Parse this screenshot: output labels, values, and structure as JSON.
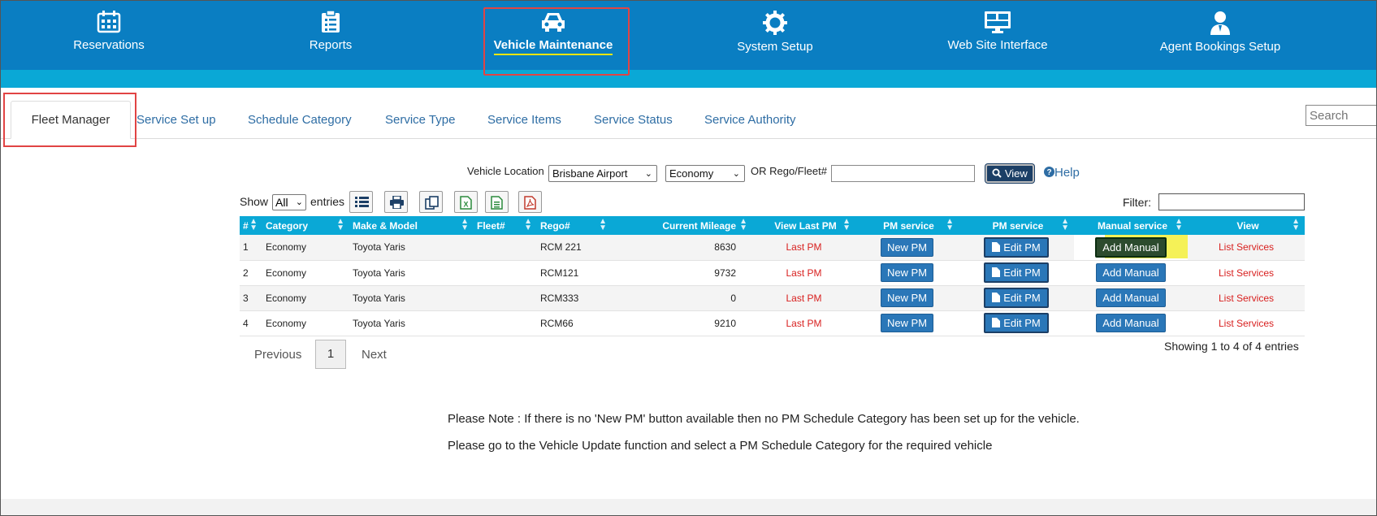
{
  "nav": {
    "items": [
      {
        "label": "Reservations",
        "icon": "calendar-icon"
      },
      {
        "label": "Reports",
        "icon": "checklist-icon"
      },
      {
        "label": "Vehicle Maintenance",
        "icon": "car-icon",
        "active": true
      },
      {
        "label": "System Setup",
        "icon": "gear-icon"
      },
      {
        "label": "Web Site Interface",
        "icon": "monitor-icon"
      },
      {
        "label": "Agent Bookings Setup",
        "icon": "user-icon"
      }
    ],
    "color": "#0a7ec2",
    "strip_color": "#0aa8d6"
  },
  "tabs": [
    {
      "label": "Fleet Manager",
      "active": true
    },
    {
      "label": "Service Set up"
    },
    {
      "label": "Schedule Category"
    },
    {
      "label": "Service Type"
    },
    {
      "label": "Service Items"
    },
    {
      "label": "Service Status"
    },
    {
      "label": "Service Authority"
    }
  ],
  "search": {
    "placeholder": "Search"
  },
  "filters": {
    "location_label": "Vehicle Location",
    "location_value": "Brisbane Airport",
    "category_value": "Economy",
    "rego_label": "OR Rego/Fleet#",
    "view_label": "View",
    "help_label": "Help"
  },
  "toolbar": {
    "show_label": "Show",
    "show_value": "All",
    "entries_label": "entries",
    "filter_label": "Filter:",
    "buttons": [
      "list-icon",
      "print-icon",
      "copy-icon",
      "excel-icon",
      "csv-icon",
      "pdf-icon"
    ]
  },
  "table": {
    "headers": [
      "#",
      "Category",
      "Make & Model",
      "Fleet#",
      "Rego#",
      "Current Mileage",
      "View Last PM",
      "PM service",
      "PM service",
      "Manual service",
      "View"
    ],
    "rows": [
      {
        "n": "1",
        "category": "Economy",
        "make": "Toyota Yaris",
        "fleet": "",
        "rego": "RCM 221",
        "mileage": "8630",
        "last_pm": "Last PM",
        "new_pm": "New PM",
        "edit_pm": "Edit PM",
        "add_manual": "Add Manual",
        "list": "List Services"
      },
      {
        "n": "2",
        "category": "Economy",
        "make": "Toyota Yaris",
        "fleet": "",
        "rego": "RCM121",
        "mileage": "9732",
        "last_pm": "Last PM",
        "new_pm": "New PM",
        "edit_pm": "Edit PM",
        "add_manual": "Add Manual",
        "list": "List Services"
      },
      {
        "n": "3",
        "category": "Economy",
        "make": "Toyota Yaris",
        "fleet": "",
        "rego": "RCM333",
        "mileage": "0",
        "last_pm": "Last PM",
        "new_pm": "New PM",
        "edit_pm": "Edit PM",
        "add_manual": "Add Manual",
        "list": "List Services"
      },
      {
        "n": "4",
        "category": "Economy",
        "make": "Toyota Yaris",
        "fleet": "",
        "rego": "RCM66",
        "mileage": "9210",
        "last_pm": "Last PM",
        "new_pm": "New PM",
        "edit_pm": "Edit PM",
        "add_manual": "Add Manual",
        "list": "List Services"
      }
    ]
  },
  "pager": {
    "previous": "Previous",
    "page": "1",
    "next": "Next",
    "showing": "Showing 1 to 4 of 4 entries"
  },
  "notes": [
    "Please Note : If there is no 'New PM' button available then no PM Schedule Category has been set up for the vehicle.",
    "Please go to the Vehicle Update function and select a PM Schedule Category for the required vehicle"
  ]
}
